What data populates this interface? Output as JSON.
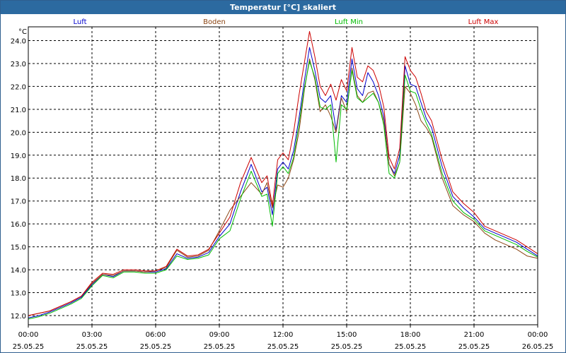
{
  "title": "Temperatur [°C] skaliert",
  "chart_data": {
    "type": "line",
    "ylabel": "°C",
    "ylim": [
      11.6,
      24.6
    ],
    "yticks": [
      "12.0",
      "13.0",
      "14.0",
      "15.0",
      "16.0",
      "17.0",
      "18.0",
      "19.0",
      "20.0",
      "21.0",
      "22.0",
      "23.0",
      "24.0"
    ],
    "xlim": [
      0,
      24
    ],
    "xticks": [
      {
        "time": "00:00",
        "date": "25.05.25"
      },
      {
        "time": "03:00",
        "date": "25.05.25"
      },
      {
        "time": "06:00",
        "date": "25.05.25"
      },
      {
        "time": "09:00",
        "date": "25.05.25"
      },
      {
        "time": "12:00",
        "date": "25.05.25"
      },
      {
        "time": "15:00",
        "date": "25.05.25"
      },
      {
        "time": "18:00",
        "date": "25.05.25"
      },
      {
        "time": "21:00",
        "date": "25.05.25"
      },
      {
        "time": "00:00",
        "date": "26.05.25"
      }
    ],
    "grid": true,
    "legend_position": "top",
    "series": [
      {
        "name": "Luft",
        "color": "#0000cc",
        "x": [
          0,
          0.5,
          1,
          1.5,
          2,
          2.5,
          3,
          3.5,
          4,
          4.5,
          5,
          5.5,
          6,
          6.5,
          7,
          7.5,
          8,
          8.5,
          9,
          9.5,
          10,
          10.5,
          11,
          11.25,
          11.5,
          11.75,
          12,
          12.25,
          12.5,
          12.75,
          13,
          13.25,
          13.5,
          13.75,
          14,
          14.25,
          14.5,
          14.75,
          15,
          15.25,
          15.5,
          15.75,
          16,
          16.25,
          16.5,
          16.75,
          17,
          17.25,
          17.5,
          17.75,
          18,
          18.25,
          18.5,
          18.75,
          19,
          19.5,
          20,
          20.5,
          21,
          21.5,
          22,
          22.5,
          23,
          23.5,
          24
        ],
        "y": [
          11.9,
          12.0,
          12.15,
          12.35,
          12.55,
          12.8,
          13.35,
          13.8,
          13.7,
          13.95,
          13.95,
          13.9,
          13.9,
          14.05,
          14.7,
          14.5,
          14.55,
          14.75,
          15.45,
          16.0,
          17.4,
          18.6,
          17.4,
          17.6,
          16.4,
          18.4,
          18.7,
          18.4,
          19.2,
          20.6,
          22.2,
          23.7,
          22.7,
          21.5,
          21.3,
          21.6,
          20.1,
          21.6,
          21.3,
          23.2,
          21.9,
          21.6,
          22.6,
          22.2,
          21.6,
          20.7,
          18.6,
          18.2,
          19.0,
          22.9,
          22.1,
          22.0,
          21.3,
          20.6,
          20.2,
          18.5,
          17.2,
          16.7,
          16.3,
          15.8,
          15.6,
          15.4,
          15.2,
          14.9,
          14.6
        ]
      },
      {
        "name": "Boden",
        "color": "#8b4513",
        "x": [
          0,
          0.5,
          1,
          1.5,
          2,
          2.5,
          3,
          3.5,
          4,
          4.5,
          5,
          5.5,
          6,
          6.5,
          7,
          7.5,
          8,
          8.5,
          9,
          9.5,
          10,
          10.5,
          11,
          11.25,
          11.5,
          11.75,
          12,
          12.25,
          12.5,
          12.75,
          13,
          13.25,
          13.5,
          13.75,
          14,
          14.25,
          14.5,
          14.75,
          15,
          15.25,
          15.5,
          15.75,
          16,
          16.25,
          16.5,
          16.75,
          17,
          17.25,
          17.5,
          17.75,
          18,
          18.25,
          18.5,
          18.75,
          19,
          19.5,
          20,
          20.5,
          21,
          21.5,
          22,
          22.5,
          23,
          23.5,
          24
        ],
        "y": [
          12.0,
          12.1,
          12.2,
          12.4,
          12.6,
          12.85,
          13.4,
          13.8,
          13.75,
          13.95,
          13.95,
          13.9,
          13.95,
          14.1,
          14.85,
          14.55,
          14.6,
          14.85,
          15.7,
          16.6,
          17.2,
          17.8,
          17.3,
          17.8,
          16.7,
          17.7,
          17.6,
          18.0,
          18.8,
          20.0,
          21.8,
          23.2,
          22.3,
          20.9,
          21.2,
          20.7,
          20.0,
          21.5,
          20.9,
          22.8,
          21.6,
          21.3,
          21.7,
          21.8,
          21.3,
          20.5,
          18.6,
          18.1,
          18.7,
          22.0,
          21.7,
          21.2,
          20.5,
          20.2,
          19.8,
          18.0,
          16.8,
          16.4,
          16.1,
          15.6,
          15.3,
          15.1,
          14.9,
          14.6,
          14.5
        ]
      },
      {
        "name": "Luft Min",
        "color": "#00bb00",
        "x": [
          0,
          0.5,
          1,
          1.5,
          2,
          2.5,
          3,
          3.5,
          4,
          4.5,
          5,
          5.5,
          6,
          6.5,
          7,
          7.5,
          8,
          8.5,
          9,
          9.5,
          10,
          10.5,
          11,
          11.25,
          11.5,
          11.75,
          12,
          12.25,
          12.5,
          12.75,
          13,
          13.25,
          13.5,
          13.75,
          14,
          14.25,
          14.5,
          14.75,
          15,
          15.25,
          15.5,
          15.75,
          16,
          16.25,
          16.5,
          16.75,
          17,
          17.25,
          17.5,
          17.75,
          18,
          18.25,
          18.5,
          18.75,
          19,
          19.5,
          20,
          20.5,
          21,
          21.5,
          22,
          22.5,
          23,
          23.5,
          24
        ],
        "y": [
          11.85,
          11.95,
          12.1,
          12.3,
          12.5,
          12.75,
          13.3,
          13.75,
          13.65,
          13.9,
          13.9,
          13.85,
          13.85,
          14.0,
          14.6,
          14.45,
          14.5,
          14.65,
          15.35,
          15.7,
          17.1,
          18.3,
          17.2,
          17.3,
          15.9,
          18.2,
          18.5,
          18.2,
          18.9,
          20.3,
          21.9,
          23.1,
          22.4,
          21.1,
          21.0,
          21.2,
          18.7,
          21.2,
          21.0,
          22.7,
          21.5,
          21.3,
          21.5,
          21.7,
          21.3,
          20.3,
          18.2,
          18.0,
          18.7,
          22.5,
          21.8,
          21.7,
          21.0,
          20.4,
          19.9,
          18.2,
          17.0,
          16.5,
          16.2,
          15.7,
          15.5,
          15.3,
          15.1,
          14.8,
          14.55
        ]
      },
      {
        "name": "Luft Max",
        "color": "#cc0000",
        "x": [
          0,
          0.5,
          1,
          1.5,
          2,
          2.5,
          3,
          3.5,
          4,
          4.5,
          5,
          5.5,
          6,
          6.5,
          7,
          7.5,
          8,
          8.5,
          9,
          9.5,
          10,
          10.5,
          11,
          11.25,
          11.5,
          11.75,
          12,
          12.25,
          12.5,
          12.75,
          13,
          13.25,
          13.5,
          13.75,
          14,
          14.25,
          14.5,
          14.75,
          15,
          15.25,
          15.5,
          15.75,
          16,
          16.25,
          16.5,
          16.75,
          17,
          17.25,
          17.5,
          17.75,
          18,
          18.25,
          18.5,
          18.75,
          19,
          19.5,
          20,
          20.5,
          21,
          21.5,
          22,
          22.5,
          23,
          23.5,
          24
        ],
        "y": [
          12.0,
          12.1,
          12.2,
          12.4,
          12.6,
          12.85,
          13.45,
          13.85,
          13.8,
          14.0,
          14.0,
          13.95,
          13.95,
          14.15,
          14.9,
          14.6,
          14.65,
          14.9,
          15.6,
          16.3,
          17.8,
          18.9,
          17.8,
          18.1,
          16.8,
          18.8,
          19.1,
          18.8,
          20.0,
          21.6,
          23.0,
          24.4,
          23.3,
          22.0,
          21.6,
          22.1,
          21.4,
          22.3,
          21.8,
          23.7,
          22.4,
          22.2,
          22.9,
          22.7,
          22.1,
          21.1,
          18.9,
          18.4,
          19.3,
          23.3,
          22.7,
          22.4,
          21.7,
          20.9,
          20.5,
          18.8,
          17.4,
          16.9,
          16.5,
          15.9,
          15.7,
          15.5,
          15.3,
          15.0,
          14.7
        ]
      }
    ]
  }
}
